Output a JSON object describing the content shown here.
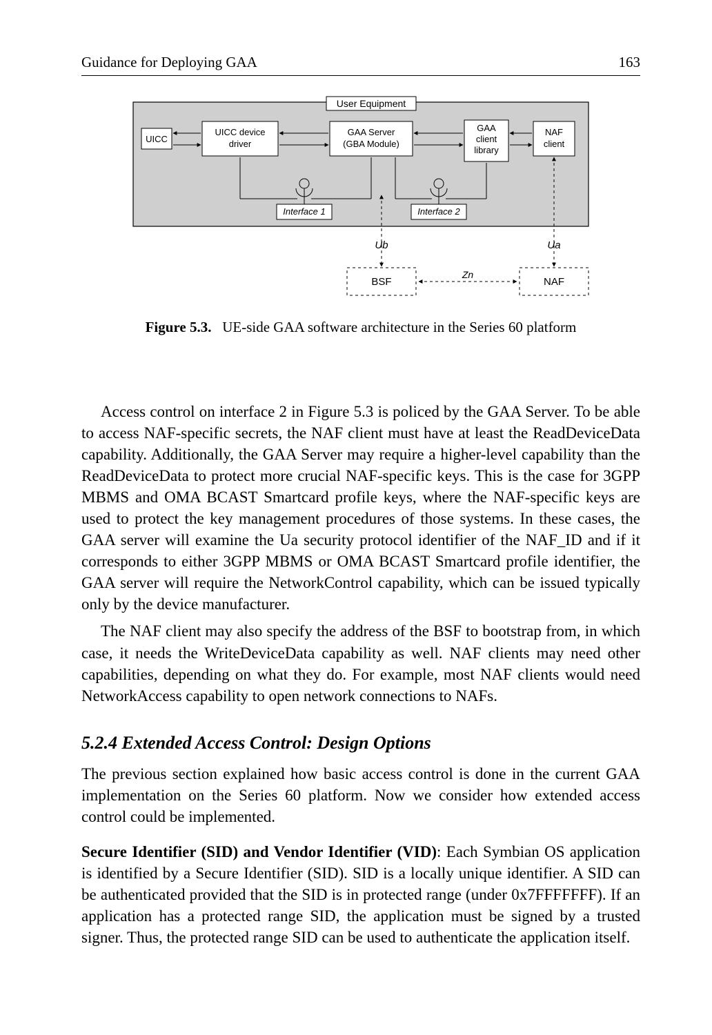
{
  "header": {
    "title": "Guidance for Deploying GAA",
    "page_number": "163"
  },
  "figure": {
    "label": "Figure 5.3.",
    "caption": "UE-side GAA software architecture in the Series 60 platform",
    "ue_label": "User Equipment",
    "uicc": "UICC",
    "uicc_driver_l1": "UICC device",
    "uicc_driver_l2": "driver",
    "gaa_server_l1": "GAA Server",
    "gaa_server_l2": "(GBA Module)",
    "gaa_lib_l1": "GAA",
    "gaa_lib_l2": "client",
    "gaa_lib_l3": "library",
    "naf_client_l1": "NAF",
    "naf_client_l2": "client",
    "iface1": "Interface 1",
    "iface2": "Interface 2",
    "ub": "Ub",
    "ua": "Ua",
    "zn": "Zn",
    "bsf": "BSF",
    "naf": "NAF"
  },
  "paragraphs": {
    "p1": "Access control on interface 2 in Figure 5.3 is policed by the GAA Server. To be able to access NAF-specific secrets, the NAF client must have at least the Read­DeviceData capability. Additionally, the GAA Server may require a higher-level capability than the ReadDeviceData to protect more crucial NAF-specific keys. This is the case for 3GPP MBMS and OMA BCAST Smartcard profile keys, where the NAF-specific keys are used to protect the key management procedures of those systems. In these cases, the GAA server will examine the Ua security protocol identi­fier of the NAF_ID and if it corresponds to either 3GPP MBMS or OMA BCAST Smartcard profile identifier, the GAA server will require the NetworkControl capabil­ity, which can be issued typically only by the device manufacturer.",
    "p2": "The NAF client may also specify the address of the BSF to bootstrap from, in which case, it needs the WriteDeviceData capability as well. NAF clients may need other capabilities, depending on what they do. For example, most NAF clients would need NetworkAccess capability to open network connections to NAFs.",
    "heading": "5.2.4 Extended Access Control: Design Options",
    "p3": "The previous section explained how basic access control is done in the current GAA implementation on the Series 60 platform. Now we consider how extended access control could be implemented.",
    "sid_label": "Secure Identifier (SID) and Vendor Identifier (VID)",
    "p4": ": Each Symbian OS applica­tion is identified by a Secure Identifier (SID). SID is a locally unique identifier. A SID can be authenticated provided that the SID is in protected range (under 0x7FFFFFFF). If an application has a protected range SID, the application must be signed by a trusted signer. Thus, the protected range SID can be used to authenticate the application itself."
  }
}
